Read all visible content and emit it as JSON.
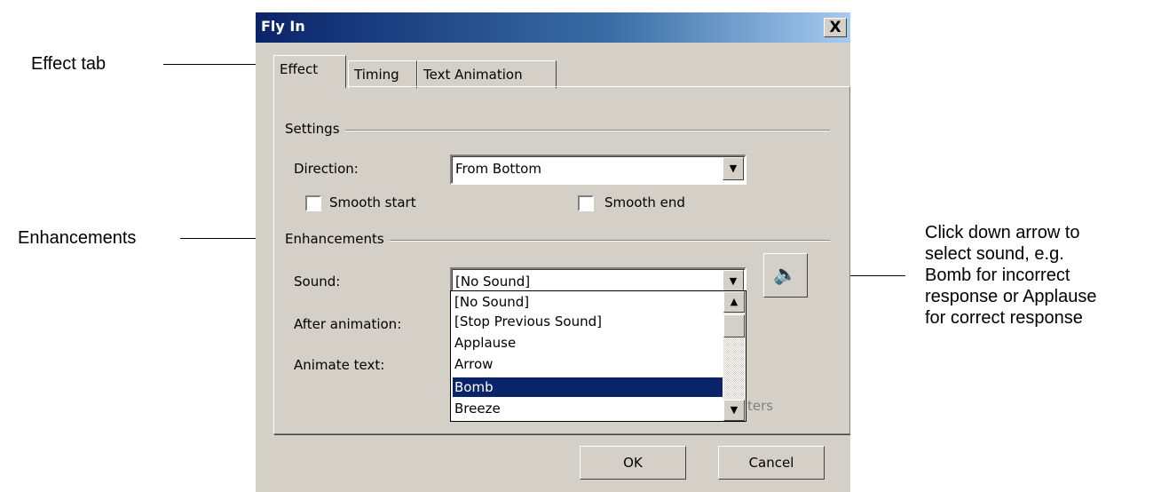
{
  "dialog": {
    "title": "Fly In",
    "close_glyph": "X",
    "tabs": [
      {
        "label": "Effect"
      },
      {
        "label": "Timing"
      },
      {
        "label": "Text Animation"
      }
    ],
    "active_tab": "Effect",
    "settings": {
      "group_label": "Settings",
      "direction_label": "Direction:",
      "direction_value": "From Bottom",
      "smooth_start_label": "Smooth start",
      "smooth_start_checked": false,
      "smooth_end_label": "Smooth end",
      "smooth_end_checked": false
    },
    "enhancements": {
      "group_label": "Enhancements",
      "sound_label": "Sound:",
      "sound_value": "[No Sound]",
      "after_animation_label": "After animation:",
      "animate_text_label": "Animate text:",
      "obscured_text_fragment": "ters",
      "sound_options": [
        "[No Sound]",
        "[Stop Previous Sound]",
        "Applause",
        "Arrow",
        "Bomb",
        "Breeze"
      ],
      "highlighted_option": "Bomb"
    },
    "buttons": {
      "ok": "OK",
      "cancel": "Cancel"
    }
  },
  "callouts": {
    "effect_tab": "Effect tab",
    "enhancements": "Enhancements",
    "sound_note_lines": [
      "Click down arrow to",
      "select sound, e.g.",
      "Bomb for incorrect",
      "response or Applause",
      "for correct response"
    ]
  },
  "icons": {
    "dropdown": "down-arrow-icon",
    "scroll_up": "up-arrow-icon",
    "scroll_down": "down-arrow-icon",
    "sound": "speaker-icon"
  },
  "colors": {
    "dialog_face": "#d4d0c8",
    "titlebar_start": "#0a246a",
    "selection": "#0a246a"
  }
}
